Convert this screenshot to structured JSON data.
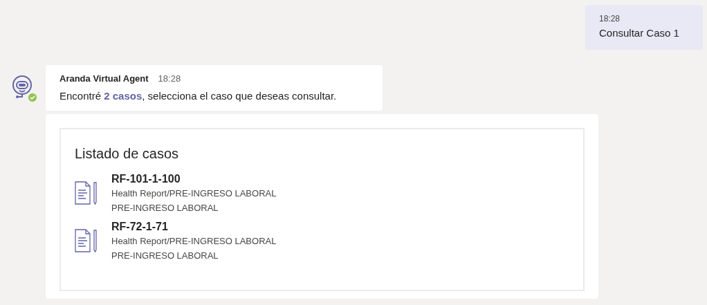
{
  "outgoing": {
    "time": "18:28",
    "text": "Consultar Caso 1"
  },
  "bot_message": {
    "sender": "Aranda Virtual Agent",
    "time": "18:28",
    "text": "Encontré **2 casos**, selecciona el caso que deseas consultar.",
    "online": true
  },
  "card": {
    "title": "Listado de casos",
    "cases": [
      {
        "id": "RF-101-1-100",
        "category": "Health Report/PRE-INGRESO LABORAL",
        "subcategory": "PRE-INGRESO LABORAL"
      },
      {
        "id": "RF-72-1-71",
        "category": "Health Report/PRE-INGRESO LABORAL",
        "subcategory": "PRE-INGRESO LABORAL"
      }
    ]
  }
}
